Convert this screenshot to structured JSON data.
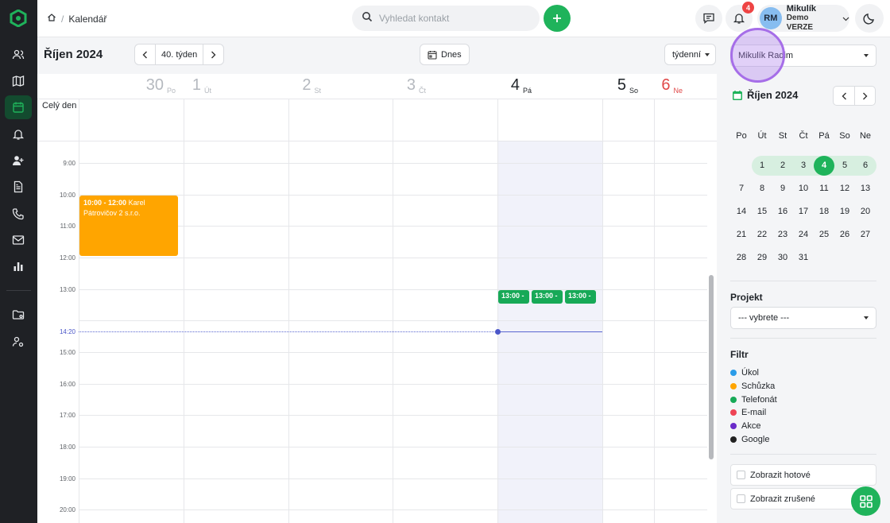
{
  "topbar": {
    "breadcrumb": "Kalendář",
    "search_placeholder": "Vyhledat kontakt",
    "notifications_count": "4",
    "user_initials": "RM",
    "user_name": "Mikulík",
    "user_subtitle": "Demo VERZE"
  },
  "calendar": {
    "month_title": "Říjen 2024",
    "week_label": "40. týden",
    "today_label": "Dnes",
    "view_label": "týdenní",
    "all_day_label": "Celý den",
    "days": [
      {
        "num": "30",
        "name": "Po"
      },
      {
        "num": "1",
        "name": "Út"
      },
      {
        "num": "2",
        "name": "St"
      },
      {
        "num": "3",
        "name": "Čt"
      },
      {
        "num": "4",
        "name": "Pá"
      },
      {
        "num": "5",
        "name": "So"
      },
      {
        "num": "6",
        "name": "Ne"
      }
    ],
    "hours": [
      "9:00",
      "10:00",
      "11:00",
      "12:00",
      "13:00",
      "15:00",
      "16:00",
      "17:00",
      "18:00",
      "19:00",
      "20:00"
    ],
    "now_label": "14:20",
    "events": {
      "meeting_time": "10:00 - 12:00",
      "meeting_title": "Karel Pátrovičov 2 s.r.o.",
      "calls": [
        "13:00 -",
        "13:00 -",
        "13:00 -"
      ]
    }
  },
  "panel": {
    "user_select": "Mikulík Radim",
    "mini_month": "Říjen 2024",
    "weekdays": [
      "Po",
      "Út",
      "St",
      "Čt",
      "Pá",
      "So",
      "Ne"
    ],
    "weeks": [
      [
        "",
        "1",
        "2",
        "3",
        "4",
        "5",
        "6"
      ],
      [
        "7",
        "8",
        "9",
        "10",
        "11",
        "12",
        "13"
      ],
      [
        "14",
        "15",
        "16",
        "17",
        "18",
        "19",
        "20"
      ],
      [
        "21",
        "22",
        "23",
        "24",
        "25",
        "26",
        "27"
      ],
      [
        "28",
        "29",
        "30",
        "31",
        "",
        "",
        ""
      ]
    ],
    "project_title": "Projekt",
    "project_select": "--- vybrete ---",
    "filter_title": "Filtr",
    "filters": [
      {
        "label": "Úkol",
        "color": "#2b9ce8"
      },
      {
        "label": "Schůzka",
        "color": "#ffa500"
      },
      {
        "label": "Telefonát",
        "color": "#17a957"
      },
      {
        "label": "E-mail",
        "color": "#ee4455"
      },
      {
        "label": "Akce",
        "color": "#6a2bc9"
      },
      {
        "label": "Google",
        "color": "#222222"
      }
    ],
    "show_done": "Zobrazit hotové",
    "show_cancelled": "Zobrazit zrušené"
  }
}
